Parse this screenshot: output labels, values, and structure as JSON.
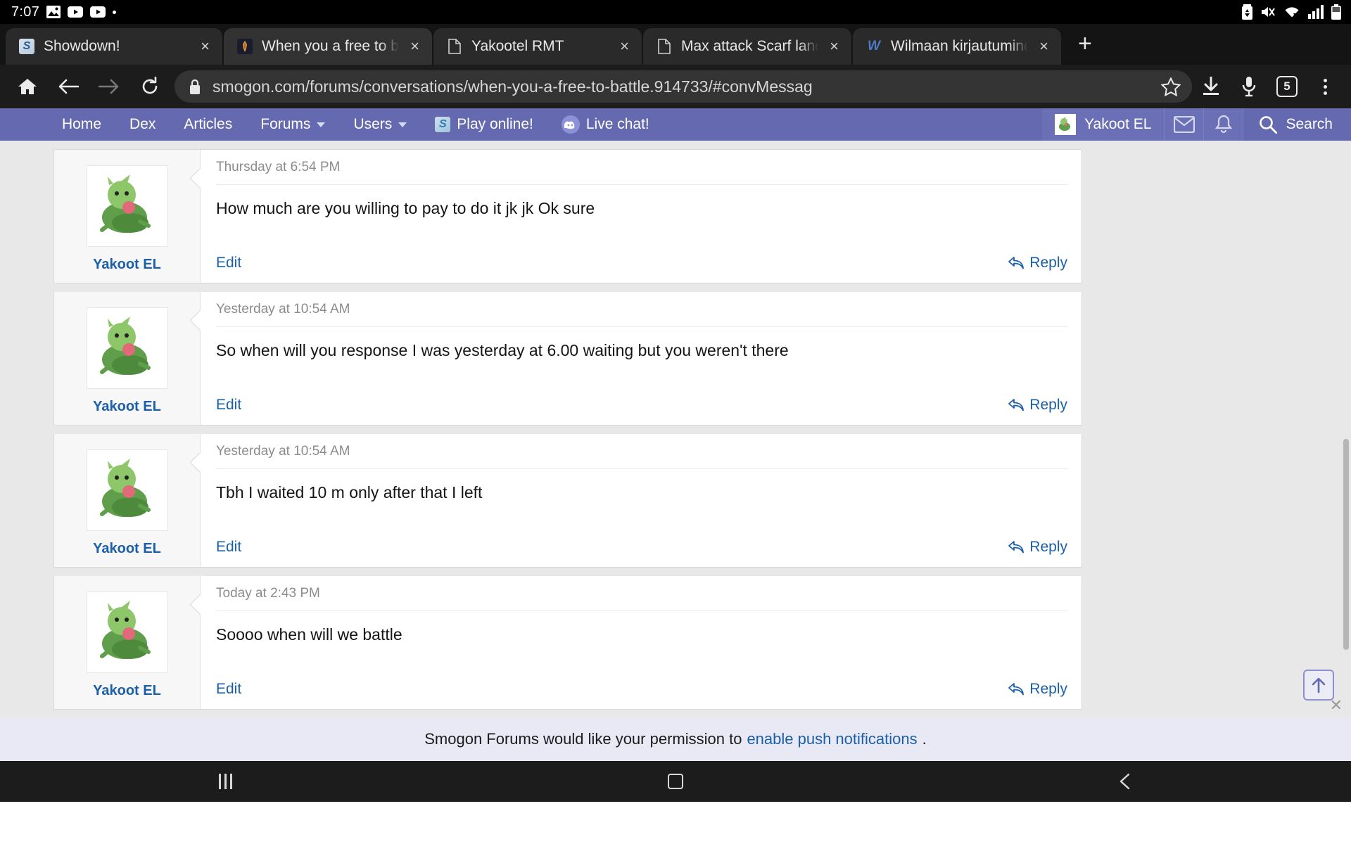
{
  "status_bar": {
    "time": "7:07",
    "left_icons": [
      "image-icon",
      "youtube-icon",
      "youtube-icon",
      "dot-icon"
    ],
    "right_icons": [
      "battery-saver-icon",
      "mute-icon",
      "wifi-icon",
      "signal-icon",
      "battery-icon"
    ]
  },
  "browser": {
    "tabs": [
      {
        "title": "Showdown!",
        "favicon": "showdown-icon",
        "close": "×",
        "active": false
      },
      {
        "title": "When you a free to bat",
        "favicon": "smogon-icon",
        "close": "×",
        "active": true
      },
      {
        "title": "Yakootel RMT",
        "favicon": "document-icon",
        "close": "×",
        "active": false
      },
      {
        "title": "Max attack Scarf land",
        "favicon": "document-icon",
        "close": "×",
        "active": false
      },
      {
        "title": "Wilmaan kirjautuminen",
        "favicon": "wikipedia-icon",
        "close": "×",
        "active": false
      }
    ],
    "new_tab_label": "+",
    "url": "smogon.com/forums/conversations/when-you-a-free-to-battle.914733/#convMessag",
    "tab_count": "5",
    "toolbar_icons": [
      "home-icon",
      "back-icon",
      "forward-icon",
      "reload-icon",
      "lock-icon",
      "bookmark-star-icon",
      "download-icon",
      "microphone-icon",
      "tab-counter-icon",
      "overflow-menu-icon"
    ]
  },
  "site_nav": {
    "items": [
      {
        "label": "Home",
        "has_caret": false
      },
      {
        "label": "Dex",
        "has_caret": false
      },
      {
        "label": "Articles",
        "has_caret": false
      },
      {
        "label": "Forums",
        "has_caret": true
      },
      {
        "label": "Users",
        "has_caret": true
      }
    ],
    "play_online": "Play online!",
    "live_chat": "Live chat!",
    "username": "Yakoot EL",
    "search_label": "Search",
    "accent_color": "#6569b0",
    "link_color": "#1a5fa8"
  },
  "conversation": {
    "messages": [
      {
        "author": "Yakoot EL",
        "time": "Thursday at 6:54 PM",
        "text": "How much are you willing to pay to do it jk jk Ok sure",
        "edit_label": "Edit",
        "reply_label": "Reply"
      },
      {
        "author": "Yakoot EL",
        "time": "Yesterday at 10:54 AM",
        "text": "So when will you response I was yesterday at 6.00 waiting but you weren't there",
        "edit_label": "Edit",
        "reply_label": "Reply"
      },
      {
        "author": "Yakoot EL",
        "time": "Yesterday at 10:54 AM",
        "text": "Tbh I waited 10 m only after that I left",
        "edit_label": "Edit",
        "reply_label": "Reply"
      },
      {
        "author": "Yakoot EL",
        "time": "Today at 2:43 PM",
        "text": "Soooo when will we battle",
        "edit_label": "Edit",
        "reply_label": "Reply"
      }
    ]
  },
  "notification_bar": {
    "text": "Smogon Forums would like your permission to",
    "link": "enable push notifications",
    "suffix": "."
  },
  "android_nav": {
    "recents": "recents-icon",
    "home": "home-icon",
    "back": "back-icon"
  }
}
